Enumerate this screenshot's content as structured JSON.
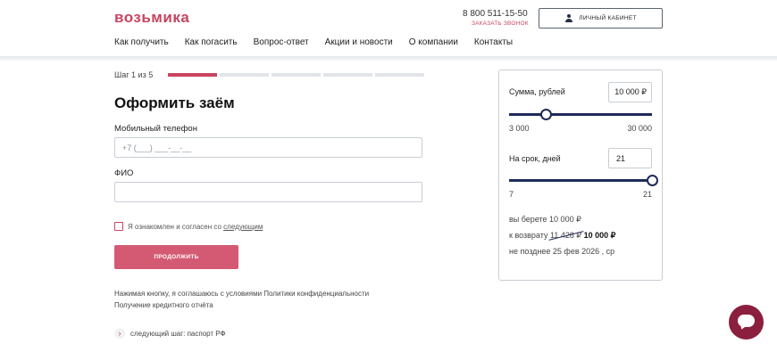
{
  "header": {
    "logo": "возьмика",
    "phone": "8 800 511-15-50",
    "callback": "ЗАКАЗАТЬ ЗВОНОК",
    "cabinet": "ЛИЧНЫЙ КАБИНЕТ",
    "nav": [
      "Как получить",
      "Как погасить",
      "Вопрос-ответ",
      "Акции и новости",
      "О компании",
      "Контакты"
    ]
  },
  "form": {
    "step_label": "Шаг 1 из 5",
    "steps_total": 5,
    "steps_active": 1,
    "title": "Оформить заём",
    "phone_label": "Мобильный телефон",
    "phone_placeholder": "+7 (___) ___-__-__",
    "name_label": "ФИО",
    "name_value": "",
    "agree_text": "Я ознакомлен и согласен со",
    "agree_link": "следующим",
    "continue": "ПРОДОЛЖИТЬ",
    "notice_1": "Нажимая кнопку, я соглашаюсь с условиями Политики конфиденциальности",
    "notice_2": "Получение кредитного отчёта",
    "next_step": "следующий шаг: паспорт РФ"
  },
  "calculator": {
    "sum_label": "Сумма, рублей",
    "sum_value": "10 000 ₽",
    "sum_min": "3 000",
    "sum_max": "30 000",
    "sum_level": 0.26,
    "term_label": "На срок, дней",
    "term_value": "21",
    "term_min": "7",
    "term_max": "21",
    "term_level": 1.0,
    "take_text": "вы берете 10 000 ₽",
    "return_prefix": "к возврату",
    "return_old": "11 428 ₽",
    "return_new": "10 000 ₽",
    "due_text": "не позднее 25 фев 2026 , ср"
  },
  "colors": {
    "brand": "#c9435f",
    "slider": "#1f2a5a",
    "chat": "#8b1f3e"
  },
  "icons": [
    "user-icon",
    "chevron-right-icon",
    "chat-icon"
  ]
}
